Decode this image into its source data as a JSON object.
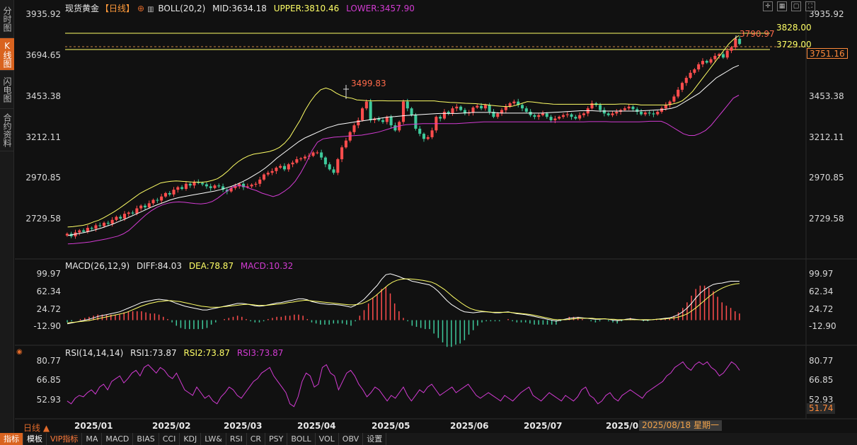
{
  "sidebar": {
    "tabs": [
      {
        "label": "分时图",
        "active": false
      },
      {
        "label": "K线图",
        "active": true
      },
      {
        "label": "闪电图",
        "active": false
      },
      {
        "label": "合约资料",
        "active": false
      }
    ]
  },
  "main_legend": {
    "instrument": "现货黄金",
    "period": "【日线】",
    "indicator": "BOLL(20,2)",
    "mid": "MID:3634.18",
    "upper": "UPPER:3810.46",
    "lower": "LOWER:3457.90"
  },
  "macd_legend": {
    "name": "MACD(26,12,9)",
    "diff": "DIFF:84.03",
    "dea": "DEA:78.87",
    "macd": "MACD:10.32"
  },
  "rsi_legend": {
    "name": "RSI(14,14,14)",
    "rsi1": "RSI1:73.87",
    "rsi2": "RSI2:73.87",
    "rsi3": "RSI3:73.87"
  },
  "annotations": {
    "high_label": "3499.83",
    "peak_label": "3790.97",
    "line1_label": "3828.00",
    "line2_label": "3729.00",
    "current_price": "3751.16",
    "rsi_current": "51.74"
  },
  "bottom": {
    "period_label": "日线 ▲",
    "selected_date": "2025/08/18 星期一",
    "tabs": [
      "指标",
      "模板",
      "VIP指标",
      "MA",
      "MACD",
      "BIAS",
      "CCI",
      "KDJ",
      "LW&",
      "RSI",
      "CR",
      "PSY",
      "BOLL",
      "VOL",
      "OBV",
      "设置"
    ]
  },
  "colors": {
    "up": "#ff4d4d",
    "down": "#3ec99b",
    "mid": "#ffffff",
    "upper": "#ffff66",
    "lower": "#d23bd2",
    "accent": "#d9631f"
  },
  "chart_data": [
    {
      "type": "candlestick",
      "title": "现货黄金【日线】",
      "x_ticks": [
        "2025/01",
        "2025/02",
        "2025/03",
        "2025/04",
        "2025/05",
        "2025/06",
        "2025/07",
        "2025/08"
      ],
      "y_ticks": [
        3935.92,
        3694.65,
        3453.38,
        3212.11,
        2970.85,
        2729.58
      ],
      "ylim": [
        2640,
        3960
      ],
      "horizontal_lines": [
        3828.0,
        3729.0
      ],
      "close": [
        2640,
        2625,
        2648,
        2660,
        2652,
        2675,
        2670,
        2690,
        2686,
        2705,
        2700,
        2722,
        2740,
        2730,
        2758,
        2765,
        2760,
        2790,
        2806,
        2796,
        2820,
        2840,
        2836,
        2860,
        2880,
        2872,
        2900,
        2915,
        2905,
        2935,
        2925,
        2945,
        2940,
        2932,
        2920,
        2910,
        2925,
        2920,
        2900,
        2890,
        2910,
        2920,
        2935,
        2915,
        2920,
        2930,
        2935,
        2960,
        2990,
        3000,
        3010,
        3030,
        3040,
        3020,
        3050,
        3060,
        3080,
        3085,
        3095,
        3100,
        3120,
        3120,
        3090,
        3050,
        3020,
        3000,
        3080,
        3150,
        3190,
        3240,
        3280,
        3310,
        3380,
        3420,
        3310,
        3320,
        3310,
        3300,
        3330,
        3280,
        3250,
        3300,
        3420,
        3380,
        3340,
        3260,
        3230,
        3200,
        3210,
        3250,
        3330,
        3320,
        3360,
        3350,
        3380,
        3390,
        3370,
        3350,
        3355,
        3385,
        3395,
        3380,
        3400,
        3360,
        3330,
        3350,
        3370,
        3390,
        3410,
        3420,
        3400,
        3380,
        3360,
        3340,
        3330,
        3340,
        3350,
        3330,
        3310,
        3320,
        3330,
        3340,
        3345,
        3330,
        3320,
        3340,
        3350,
        3380,
        3410,
        3400,
        3370,
        3350,
        3340,
        3350,
        3360,
        3370,
        3380,
        3390,
        3375,
        3360,
        3345,
        3355,
        3350,
        3345,
        3360,
        3380,
        3400,
        3420,
        3450,
        3490,
        3530,
        3560,
        3590,
        3610,
        3640,
        3660,
        3650,
        3670,
        3690,
        3700,
        3680,
        3720,
        3740,
        3790,
        3760
      ],
      "upper": [
        2680,
        2682,
        2686,
        2690,
        2698,
        2710,
        2720,
        2735,
        2752,
        2770,
        2790,
        2812,
        2834,
        2856,
        2878,
        2895,
        2910,
        2925,
        2940,
        2946,
        2950,
        2952,
        2950,
        2948,
        2946,
        2945,
        2944,
        2948,
        2955,
        2965,
        2985,
        3010,
        3040,
        3065,
        3085,
        3100,
        3110,
        3115,
        3120,
        3125,
        3135,
        3150,
        3175,
        3210,
        3260,
        3310,
        3370,
        3420,
        3460,
        3490,
        3500,
        3490,
        3470,
        3455,
        3445,
        3440,
        3430,
        3428,
        3425,
        3424,
        3425,
        3425,
        3424,
        3424,
        3424,
        3424,
        3424,
        3424,
        3424,
        3424,
        3424,
        3424,
        3420,
        3418,
        3415,
        3414,
        3412,
        3410,
        3409,
        3408,
        3405,
        3402,
        3398,
        3395,
        3392,
        3390,
        3392,
        3400,
        3410,
        3420,
        3418,
        3414,
        3410,
        3408,
        3405,
        3404,
        3404,
        3404,
        3404,
        3404,
        3404,
        3404,
        3404,
        3404,
        3404,
        3404,
        3404,
        3406,
        3406,
        3404,
        3404,
        3400,
        3400,
        3400,
        3400,
        3400,
        3400,
        3405,
        3412,
        3425,
        3450,
        3480,
        3520,
        3560,
        3600,
        3640,
        3680,
        3720,
        3760,
        3790,
        3810
      ],
      "mid": [
        2630,
        2636,
        2642,
        2648,
        2656,
        2665,
        2675,
        2686,
        2698,
        2712,
        2725,
        2740,
        2755,
        2770,
        2785,
        2800,
        2813,
        2825,
        2838,
        2848,
        2856,
        2862,
        2868,
        2874,
        2880,
        2886,
        2892,
        2900,
        2910,
        2920,
        2933,
        2948,
        2965,
        2985,
        3005,
        3028,
        3055,
        3085,
        3110,
        3135,
        3160,
        3185,
        3205,
        3220,
        3235,
        3250,
        3265,
        3275,
        3285,
        3290,
        3295,
        3300,
        3305,
        3310,
        3315,
        3320,
        3325,
        3330,
        3332,
        3335,
        3338,
        3340,
        3342,
        3344,
        3346,
        3348,
        3350,
        3350,
        3350,
        3350,
        3352,
        3354,
        3356,
        3356,
        3356,
        3356,
        3354,
        3352,
        3352,
        3352,
        3352,
        3352,
        3352,
        3352,
        3352,
        3354,
        3356,
        3358,
        3360,
        3362,
        3364,
        3366,
        3366,
        3366,
        3364,
        3364,
        3364,
        3364,
        3364,
        3364,
        3364,
        3364,
        3366,
        3368,
        3370,
        3372,
        3375,
        3380,
        3390,
        3410,
        3430,
        3450,
        3470,
        3500,
        3530,
        3560,
        3580,
        3600,
        3620,
        3634
      ],
      "lower": [
        2580,
        2582,
        2585,
        2588,
        2592,
        2598,
        2604,
        2610,
        2618,
        2626,
        2640,
        2660,
        2690,
        2720,
        2750,
        2775,
        2795,
        2810,
        2820,
        2826,
        2828,
        2826,
        2822,
        2818,
        2816,
        2820,
        2830,
        2850,
        2875,
        2900,
        2920,
        2925,
        2918,
        2905,
        2895,
        2880,
        2870,
        2860,
        2870,
        2890,
        2915,
        2950,
        3000,
        3060,
        3130,
        3180,
        3200,
        3205,
        3210,
        3212,
        3215,
        3218,
        3220,
        3222,
        3228,
        3234,
        3240,
        3250,
        3260,
        3270,
        3278,
        3284,
        3286,
        3288,
        3290,
        3290,
        3290,
        3290,
        3290,
        3290,
        3290,
        3292,
        3294,
        3296,
        3298,
        3300,
        3300,
        3300,
        3300,
        3300,
        3300,
        3300,
        3300,
        3300,
        3300,
        3300,
        3300,
        3300,
        3300,
        3300,
        3300,
        3300,
        3300,
        3300,
        3302,
        3302,
        3302,
        3302,
        3300,
        3300,
        3300,
        3300,
        3300,
        3300,
        3302,
        3304,
        3304,
        3304,
        3290,
        3270,
        3250,
        3230,
        3220,
        3220,
        3232,
        3250,
        3280,
        3320,
        3360,
        3400,
        3440,
        3458
      ]
    },
    {
      "type": "macd",
      "title": "MACD(26,12,9)",
      "y_ticks": [
        99.97,
        62.34,
        24.72,
        -12.9
      ],
      "ylim": [
        -20,
        105
      ],
      "diff": [
        -8,
        -6,
        -4,
        -2,
        0,
        2,
        5,
        8,
        10,
        12,
        14,
        16,
        18,
        22,
        26,
        30,
        34,
        38,
        40,
        42,
        44,
        45,
        44,
        43,
        40,
        36,
        33,
        30,
        28,
        26,
        24,
        22,
        22,
        24,
        26,
        28,
        30,
        32,
        34,
        36,
        36,
        35,
        33,
        31,
        30,
        31,
        33,
        35,
        37,
        38,
        40,
        42,
        44,
        46,
        46,
        44,
        40,
        38,
        36,
        35,
        34,
        34,
        33,
        32,
        30,
        28,
        32,
        38,
        45,
        55,
        65,
        75,
        88,
        98,
        100,
        97,
        94,
        90,
        88,
        84,
        82,
        80,
        78,
        76,
        70,
        62,
        52,
        42,
        34,
        28,
        22,
        18,
        17,
        16,
        17,
        18,
        18,
        17,
        16,
        16,
        17,
        18,
        16,
        14,
        13,
        12,
        10,
        8,
        6,
        4,
        2,
        0,
        -2,
        0,
        2,
        4,
        5,
        6,
        5,
        4,
        3,
        2,
        2,
        3,
        2,
        0,
        -1,
        0,
        2,
        3,
        2,
        1,
        0,
        0,
        1,
        2,
        3,
        4,
        5,
        8,
        12,
        18,
        26,
        36,
        48,
        58,
        66,
        72,
        77,
        79,
        80,
        82,
        84,
        84,
        84
      ],
      "dea": [
        -6,
        -5,
        -4,
        -3,
        -2,
        -1,
        1,
        3,
        5,
        7,
        9,
        11,
        13,
        15,
        18,
        22,
        26,
        30,
        33,
        36,
        38,
        40,
        41,
        42,
        42,
        41,
        40,
        38,
        36,
        34,
        32,
        30,
        29,
        28,
        28,
        28,
        29,
        30,
        31,
        32,
        33,
        34,
        34,
        33,
        32,
        32,
        32,
        33,
        34,
        35,
        36,
        38,
        39,
        41,
        42,
        43,
        42,
        41,
        40,
        39,
        38,
        37,
        36,
        35,
        34,
        33,
        33,
        34,
        36,
        40,
        45,
        52,
        60,
        68,
        76,
        82,
        86,
        88,
        89,
        89,
        88,
        87,
        86,
        84,
        82,
        78,
        72,
        66,
        58,
        50,
        43,
        36,
        30,
        25,
        22,
        20,
        19,
        18,
        17,
        17,
        17,
        17,
        17,
        16,
        15,
        14,
        13,
        12,
        10,
        8,
        6,
        4,
        2,
        1,
        1,
        1,
        2,
        3,
        4,
        4,
        4,
        4,
        3,
        3,
        3,
        2,
        2,
        1,
        1,
        1,
        1,
        1,
        1,
        1,
        1,
        1,
        2,
        2,
        3,
        4,
        5,
        7,
        10,
        14,
        20,
        27,
        35,
        43,
        51,
        58,
        64,
        69,
        73,
        76,
        78,
        79
      ]
    },
    {
      "type": "line",
      "title": "RSI(14,14,14)",
      "y_ticks": [
        80.77,
        66.85,
        52.93
      ],
      "ylim": [
        45,
        85
      ],
      "values": [
        52,
        50,
        54,
        56,
        55,
        58,
        60,
        57,
        62,
        64,
        60,
        66,
        68,
        70,
        65,
        68,
        72,
        74,
        70,
        76,
        78,
        75,
        72,
        76,
        74,
        70,
        68,
        72,
        66,
        60,
        58,
        56,
        62,
        58,
        54,
        56,
        52,
        50,
        55,
        58,
        62,
        60,
        56,
        54,
        58,
        62,
        66,
        68,
        72,
        74,
        76,
        70,
        66,
        62,
        58,
        50,
        48,
        55,
        66,
        72,
        70,
        62,
        64,
        76,
        78,
        72,
        70,
        60,
        66,
        72,
        74,
        70,
        64,
        60,
        55,
        58,
        62,
        60,
        56,
        52,
        56,
        54,
        58,
        62,
        56,
        52,
        56,
        60,
        58,
        62,
        64,
        60,
        56,
        58,
        60,
        62,
        58,
        60,
        62,
        64,
        60,
        56,
        54,
        56,
        58,
        56,
        54,
        52,
        56,
        54,
        52,
        55,
        58,
        60,
        62,
        56,
        54,
        52,
        55,
        58,
        56,
        54,
        52,
        56,
        54,
        52,
        55,
        60,
        62,
        56,
        54,
        50,
        52,
        56,
        58,
        54,
        52,
        56,
        58,
        60,
        58,
        56,
        54,
        58,
        60,
        62,
        64,
        66,
        70,
        72,
        76,
        78,
        80,
        76,
        74,
        78,
        80,
        78,
        80,
        76,
        74,
        70,
        72,
        76,
        80,
        78,
        74
      ],
      "current": 51.74
    }
  ]
}
